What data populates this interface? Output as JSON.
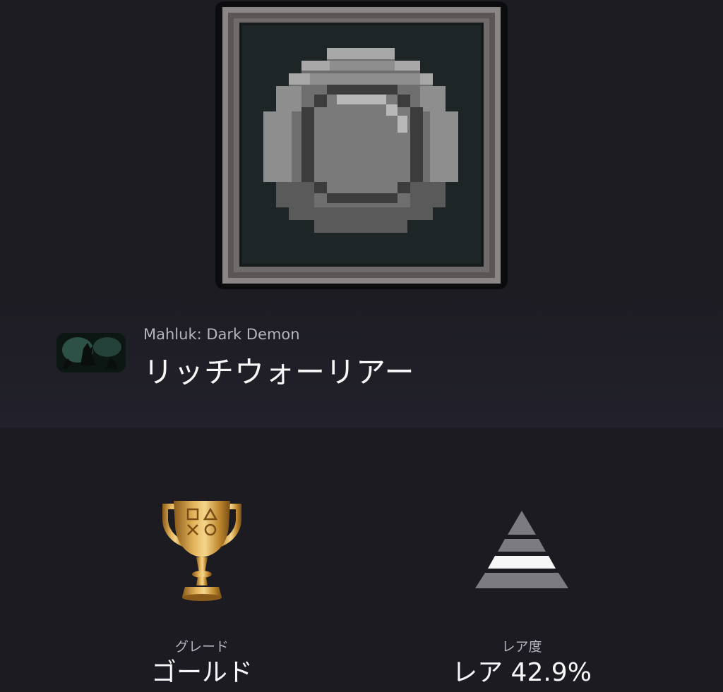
{
  "trophy": {
    "game_title": "Mahluk: Dark Demon",
    "name": "リッチウォーリアー",
    "art_icon": "pixel-shield-icon",
    "game_thumbnail_icon": "game-cover-thumbnail"
  },
  "stats": {
    "grade": {
      "label": "グレード",
      "value": "ゴールド",
      "icon": "gold-trophy-icon",
      "color": "#c8902e"
    },
    "rarity": {
      "label": "レア度",
      "value": "レア 42.9%",
      "icon": "rarity-pyramid-icon",
      "percent": 42.9
    }
  },
  "colors": {
    "background": "#1c1b22",
    "text_primary": "#f7f7f7",
    "text_secondary": "#b4b4bc"
  }
}
